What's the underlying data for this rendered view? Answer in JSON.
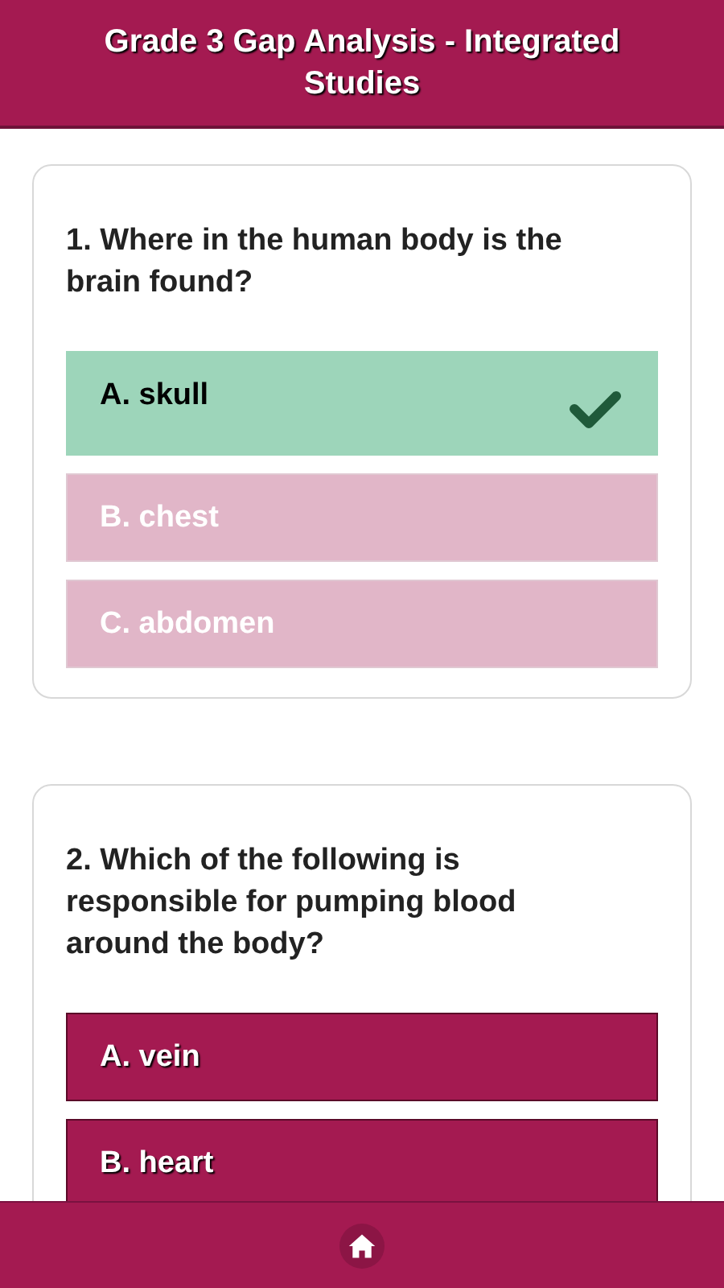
{
  "header": {
    "title": "Grade 3 Gap Analysis - Integrated Studies"
  },
  "questions": [
    {
      "text": "1. Where in the human body is the brain found?",
      "options": [
        {
          "label": "A. skull",
          "kind": "correct"
        },
        {
          "label": "B. chest",
          "kind": "dimmed"
        },
        {
          "label": "C. abdomen",
          "kind": "dimmed"
        }
      ]
    },
    {
      "text": "2. Which of the following is responsible for pumping blood around the body?",
      "options": [
        {
          "label": "A. vein",
          "kind": "open"
        },
        {
          "label": "B. heart",
          "kind": "open"
        }
      ]
    }
  ]
}
